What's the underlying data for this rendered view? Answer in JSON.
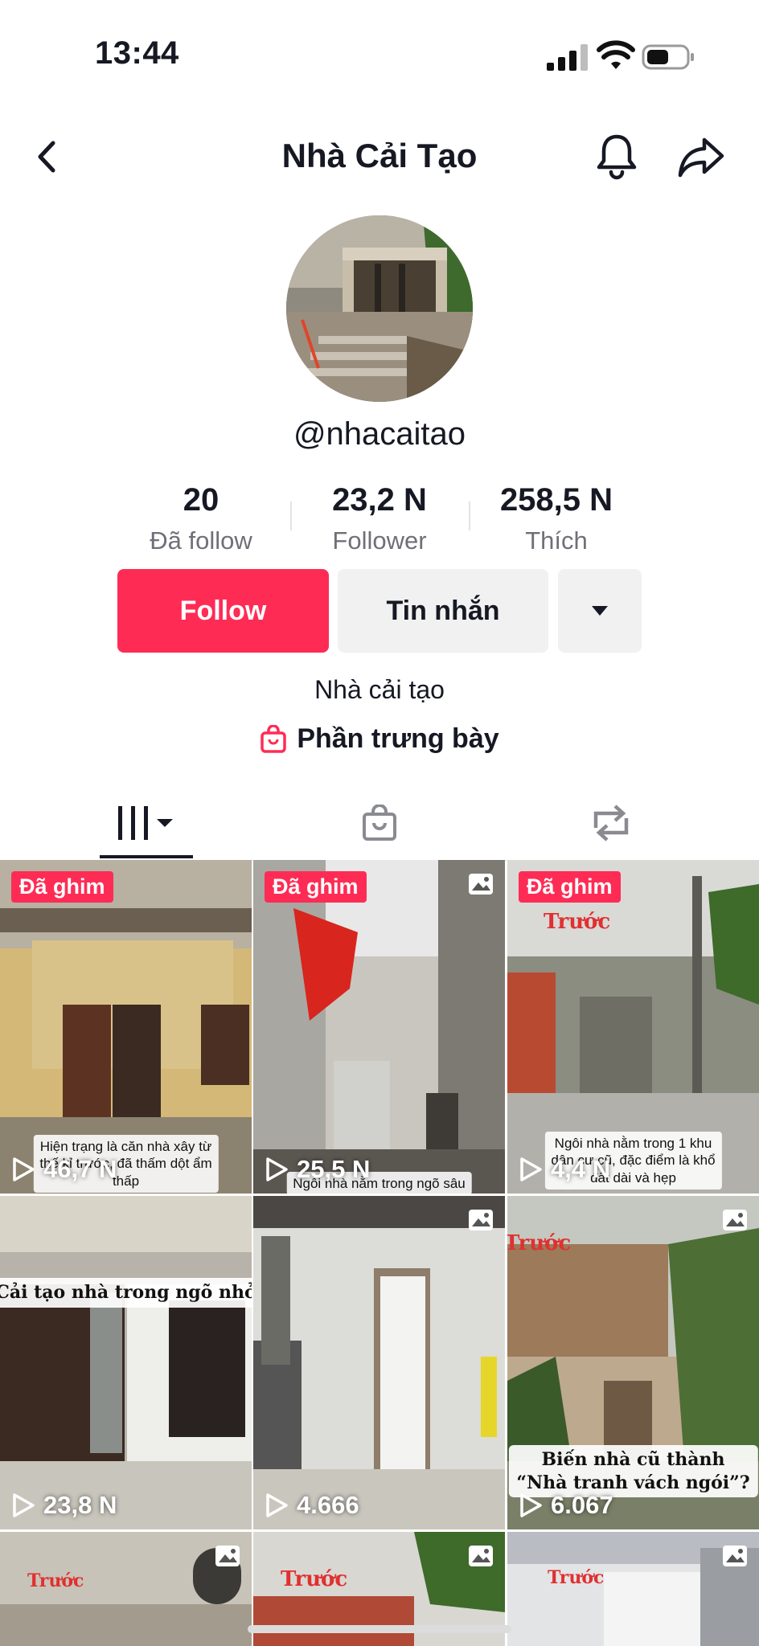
{
  "status": {
    "time": "13:44"
  },
  "header": {
    "title": "Nhà Cải Tạo"
  },
  "profile": {
    "handle": "@nhacaitao",
    "stats": [
      {
        "value": "20",
        "label": "Đã follow"
      },
      {
        "value": "23,2 N",
        "label": "Follower"
      },
      {
        "value": "258,5 N",
        "label": "Thích"
      }
    ],
    "follow_label": "Follow",
    "message_label": "Tin nhắn",
    "bio": "Nhà cải tạo",
    "showcase_label": "Phần trưng bày"
  },
  "grid": {
    "pinned_label": "Đã ghim",
    "videos": [
      {
        "views": "46,7 N",
        "caption": "Hiện trạng là căn nhà xây từ\nthế kỉ trước, đã thấm dột ẩm\nthấp"
      },
      {
        "views": "25,5 N",
        "caption": "Ngôi nhà nằm trong ngõ sâu"
      },
      {
        "views": "4,4 N",
        "caption": "Ngôi nhà nằm trong 1 khu\ndân cư cũ, đặc điểm là khổ\nđất dài và hẹp",
        "overlay": "Trước"
      },
      {
        "views": "23,8 N",
        "caption": "Cải tạo nhà trong ngõ nhỏ"
      },
      {
        "views": "4.666"
      },
      {
        "views": "6.067",
        "caption": "Biến nhà cũ thành\n“Nhà tranh vách ngói”?",
        "overlay": "Trước"
      },
      {
        "overlay": "Trước"
      },
      {
        "overlay": "Trước"
      },
      {
        "overlay": "Trước"
      }
    ]
  },
  "colors": {
    "accent": "#fe2c55",
    "text": "#161823",
    "muted": "#6f7077",
    "button_gray": "#f1f1f2"
  }
}
